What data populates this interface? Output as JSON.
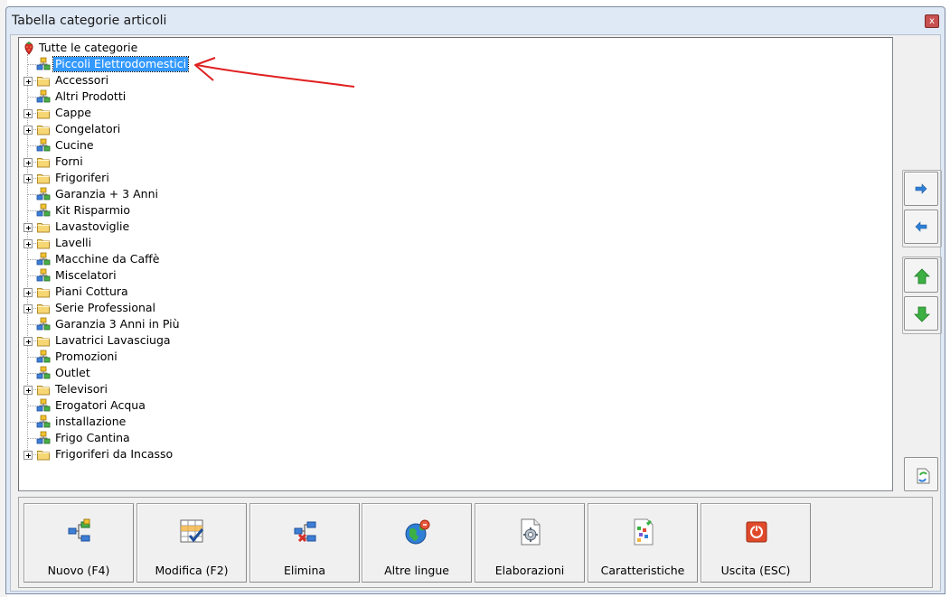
{
  "window": {
    "title": "Tabella categorie articoli",
    "close_label": "x"
  },
  "tree": {
    "root": {
      "label": "Tutte le categorie",
      "icon": "strawberry-icon"
    },
    "items": [
      {
        "label": "Piccoli Elettrodomestici",
        "type": "leaf",
        "selected": true
      },
      {
        "label": "Accessori",
        "type": "folder"
      },
      {
        "label": "Altri Prodotti",
        "type": "leaf"
      },
      {
        "label": "Cappe",
        "type": "folder"
      },
      {
        "label": "Congelatori",
        "type": "folder"
      },
      {
        "label": "Cucine",
        "type": "leaf"
      },
      {
        "label": "Forni",
        "type": "folder"
      },
      {
        "label": "Frigoriferi",
        "type": "folder"
      },
      {
        "label": "Garanzia + 3 Anni",
        "type": "leaf"
      },
      {
        "label": "Kit Risparmio",
        "type": "leaf"
      },
      {
        "label": "Lavastoviglie",
        "type": "folder"
      },
      {
        "label": "Lavelli",
        "type": "folder"
      },
      {
        "label": "Macchine da Caffè",
        "type": "leaf"
      },
      {
        "label": "Miscelatori",
        "type": "leaf"
      },
      {
        "label": "Piani Cottura",
        "type": "folder"
      },
      {
        "label": "Serie Professional",
        "type": "folder"
      },
      {
        "label": "Garanzia 3 Anni in Più",
        "type": "leaf"
      },
      {
        "label": "Lavatrici Lavasciuga",
        "type": "folder"
      },
      {
        "label": "Promozioni",
        "type": "leaf"
      },
      {
        "label": "Outlet",
        "type": "leaf"
      },
      {
        "label": "Televisori",
        "type": "folder"
      },
      {
        "label": "Erogatori Acqua",
        "type": "leaf"
      },
      {
        "label": "installazione",
        "type": "leaf"
      },
      {
        "label": "Frigo Cantina",
        "type": "leaf"
      },
      {
        "label": "Frigoriferi da Incasso",
        "type": "folder"
      }
    ]
  },
  "side_buttons": [
    {
      "name": "move-right-button",
      "icon": "arrow-right-icon",
      "color": "#2f7fd6"
    },
    {
      "name": "move-left-button",
      "icon": "arrow-left-icon",
      "color": "#2f7fd6"
    },
    {
      "name": "move-up-button",
      "icon": "arrow-up-icon",
      "color": "#3cb043"
    },
    {
      "name": "move-down-button",
      "icon": "arrow-down-icon",
      "color": "#3cb043"
    },
    {
      "name": "refresh-button",
      "icon": "refresh-document-icon"
    }
  ],
  "toolbar": [
    {
      "name": "new-button",
      "label": "Nuovo (F4)",
      "icon": "new-node-icon"
    },
    {
      "name": "edit-button",
      "label": "Modifica (F2)",
      "icon": "edit-grid-icon"
    },
    {
      "name": "delete-button",
      "label": "Elimina",
      "icon": "delete-node-icon"
    },
    {
      "name": "languages-button",
      "label": "Altre lingue",
      "icon": "globe-icon"
    },
    {
      "name": "processing-button",
      "label": "Elaborazioni",
      "icon": "gear-document-icon"
    },
    {
      "name": "features-button",
      "label": "Caratteristiche",
      "icon": "features-icon"
    },
    {
      "name": "exit-button",
      "label": "Uscita (ESC)",
      "icon": "power-icon"
    }
  ],
  "colors": {
    "selection": "#3399ff",
    "annotation_arrow": "#e02020",
    "folder": "#f7d774",
    "window_bg": "#dfe9f5"
  }
}
